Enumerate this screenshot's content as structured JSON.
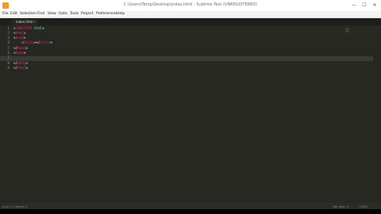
{
  "window": {
    "title": "C:\\Users\\Temp\\Desktop\\index.html - Sublime Text (UNREGISTERED)",
    "minimize": "—",
    "maximize": "☐",
    "close": "✕"
  },
  "menu": [
    "File",
    "Edit",
    "Selection",
    "Find",
    "View",
    "Goto",
    "Tools",
    "Project",
    "Preferences",
    "Help"
  ],
  "tab": {
    "label": "index.html",
    "close": "×"
  },
  "lines": [
    {
      "num": "1",
      "parts": [
        {
          "t": "<",
          "c": "white"
        },
        {
          "t": "!DOCTYPE",
          "c": "tag"
        },
        {
          "t": " html",
          "c": "kw"
        },
        {
          "t": ">",
          "c": "white"
        }
      ]
    },
    {
      "num": "2",
      "parts": [
        {
          "t": "<",
          "c": "white"
        },
        {
          "t": "html",
          "c": "tag"
        },
        {
          "t": ">",
          "c": "white"
        }
      ]
    },
    {
      "num": "3",
      "parts": [
        {
          "t": "<",
          "c": "white"
        },
        {
          "t": "head",
          "c": "tag"
        },
        {
          "t": ">",
          "c": "white"
        }
      ]
    },
    {
      "num": "4",
      "parts": [
        {
          "t": "    <",
          "c": "white"
        },
        {
          "t": "title",
          "c": "tag"
        },
        {
          "t": "></",
          "c": "white"
        },
        {
          "t": "title",
          "c": "tag"
        },
        {
          "t": ">",
          "c": "white"
        }
      ]
    },
    {
      "num": "5",
      "parts": [
        {
          "t": "</",
          "c": "white"
        },
        {
          "t": "head",
          "c": "tag"
        },
        {
          "t": ">",
          "c": "white"
        }
      ]
    },
    {
      "num": "6",
      "parts": [
        {
          "t": "<",
          "c": "white"
        },
        {
          "t": "body",
          "c": "tag"
        },
        {
          "t": ">",
          "c": "white"
        }
      ]
    },
    {
      "num": "7",
      "parts": []
    },
    {
      "num": "8",
      "parts": [
        {
          "t": "</",
          "c": "white"
        },
        {
          "t": "body",
          "c": "tag"
        },
        {
          "t": ">",
          "c": "white"
        }
      ]
    },
    {
      "num": "9",
      "parts": [
        {
          "t": "</",
          "c": "white"
        },
        {
          "t": "html",
          "c": "tag"
        },
        {
          "t": ">",
          "c": "white"
        }
      ]
    }
  ],
  "current_line": 7,
  "status": {
    "left": "Line 7, Column 1",
    "tab_size": "Tab Size: 4",
    "syntax": "HTML"
  },
  "colors": {
    "editor_bg": "#272822",
    "tag": "#f92672",
    "keyword": "#66d9ef",
    "text": "#f8f8f2"
  }
}
